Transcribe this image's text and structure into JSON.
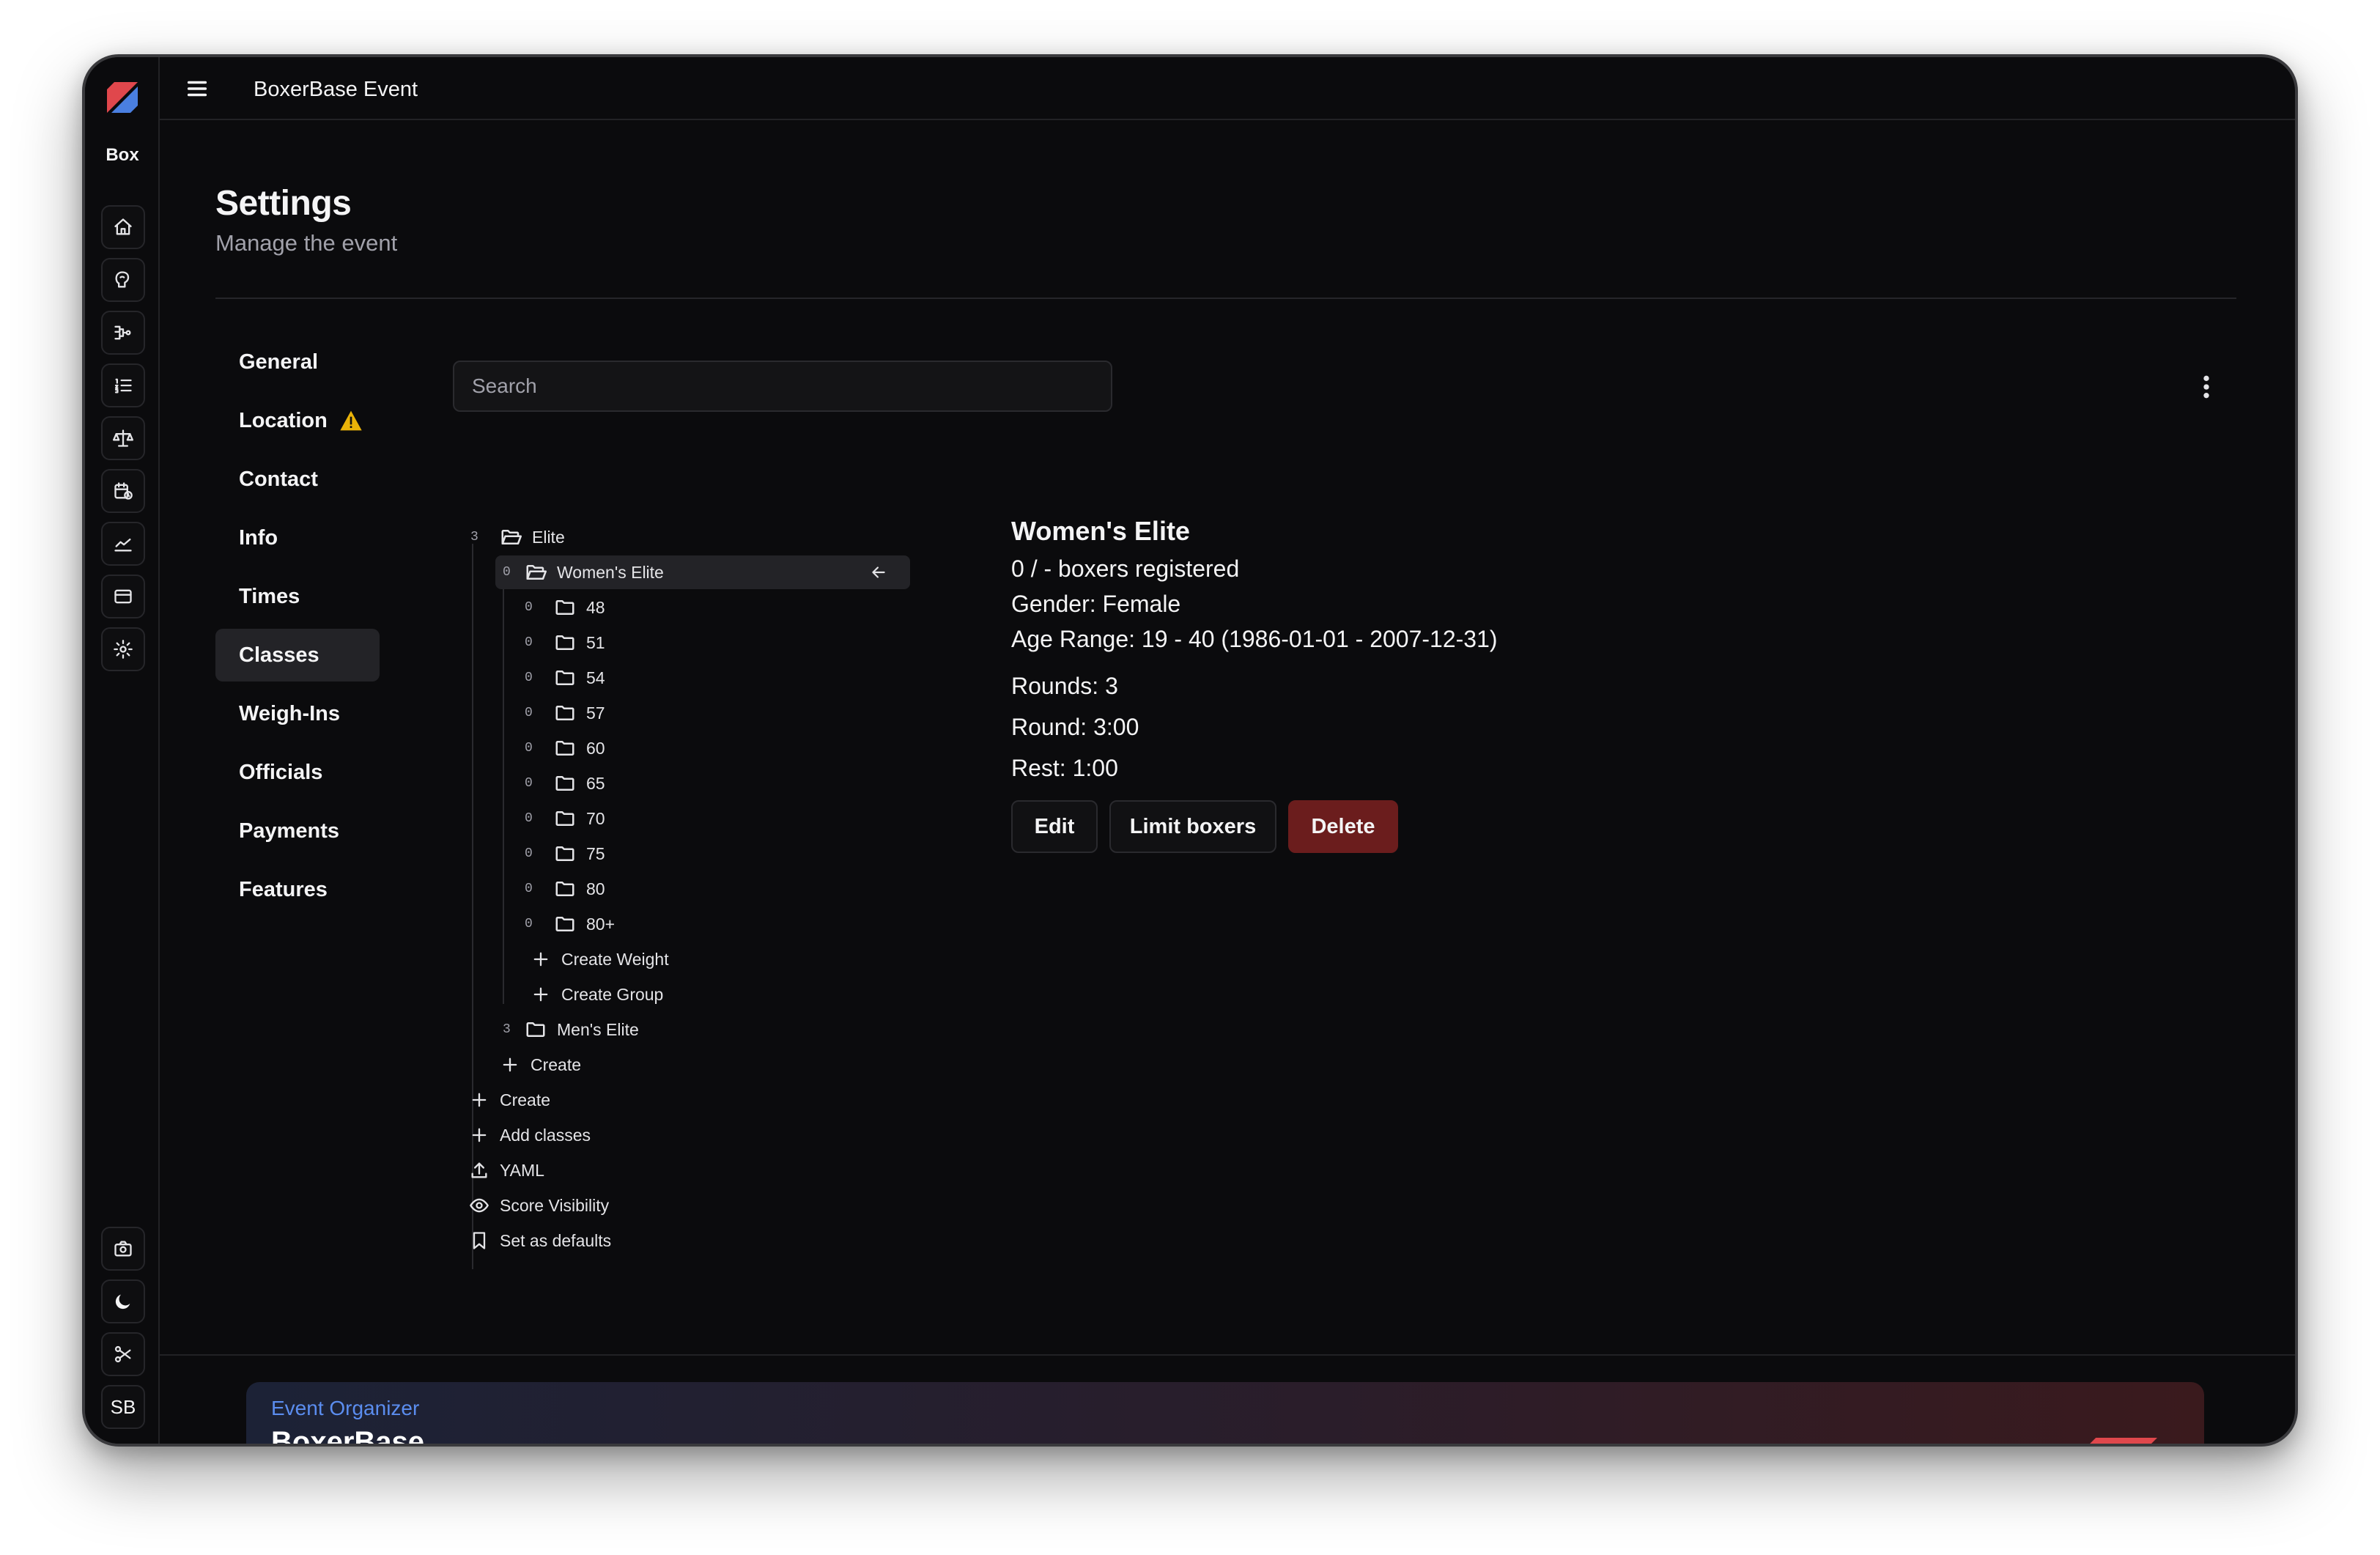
{
  "app": {
    "title": "BoxerBase Event",
    "brand_short": "Box",
    "user_initials": "SB"
  },
  "page": {
    "title": "Settings",
    "subtitle": "Manage the event"
  },
  "settings_nav": [
    {
      "label": "General"
    },
    {
      "label": "Location",
      "warning": true
    },
    {
      "label": "Contact"
    },
    {
      "label": "Info"
    },
    {
      "label": "Times"
    },
    {
      "label": "Classes",
      "active": true
    },
    {
      "label": "Weigh-Ins"
    },
    {
      "label": "Officials"
    },
    {
      "label": "Payments"
    },
    {
      "label": "Features"
    }
  ],
  "search": {
    "placeholder": "Search"
  },
  "tree": {
    "root": {
      "count": "3",
      "label": "Elite"
    },
    "group_selected": {
      "count": "0",
      "label": "Women's Elite"
    },
    "weights": [
      {
        "count": "0",
        "label": "48"
      },
      {
        "count": "0",
        "label": "51"
      },
      {
        "count": "0",
        "label": "54"
      },
      {
        "count": "0",
        "label": "57"
      },
      {
        "count": "0",
        "label": "60"
      },
      {
        "count": "0",
        "label": "65"
      },
      {
        "count": "0",
        "label": "70"
      },
      {
        "count": "0",
        "label": "75"
      },
      {
        "count": "0",
        "label": "80"
      },
      {
        "count": "0",
        "label": "80+"
      }
    ],
    "create_weight": "Create Weight",
    "create_group": "Create Group",
    "group_other": {
      "count": "3",
      "label": "Men's Elite"
    },
    "create_inner": "Create",
    "actions": {
      "create": "Create",
      "add_classes": "Add classes",
      "yaml": "YAML",
      "score_visibility": "Score Visibility",
      "set_defaults": "Set as defaults"
    }
  },
  "detail": {
    "title": "Women's Elite",
    "registered": "0 / - boxers registered",
    "gender": "Gender: Female",
    "age_range": "Age Range: 19 - 40 (1986-01-01 - 2007-12-31)",
    "rounds": "Rounds: 3",
    "round": "Round: 3:00",
    "rest": "Rest: 1:00",
    "buttons": {
      "edit": "Edit",
      "limit": "Limit boxers",
      "delete": "Delete"
    }
  },
  "footer": {
    "kicker": "Event Organizer",
    "title": "BoxerBase"
  },
  "colors": {
    "accent_blue": "#5b8def",
    "danger": "#6b1d1d",
    "brand_red": "#e0474c",
    "brand_blue": "#4a7fe0",
    "warning": "#eab308"
  }
}
